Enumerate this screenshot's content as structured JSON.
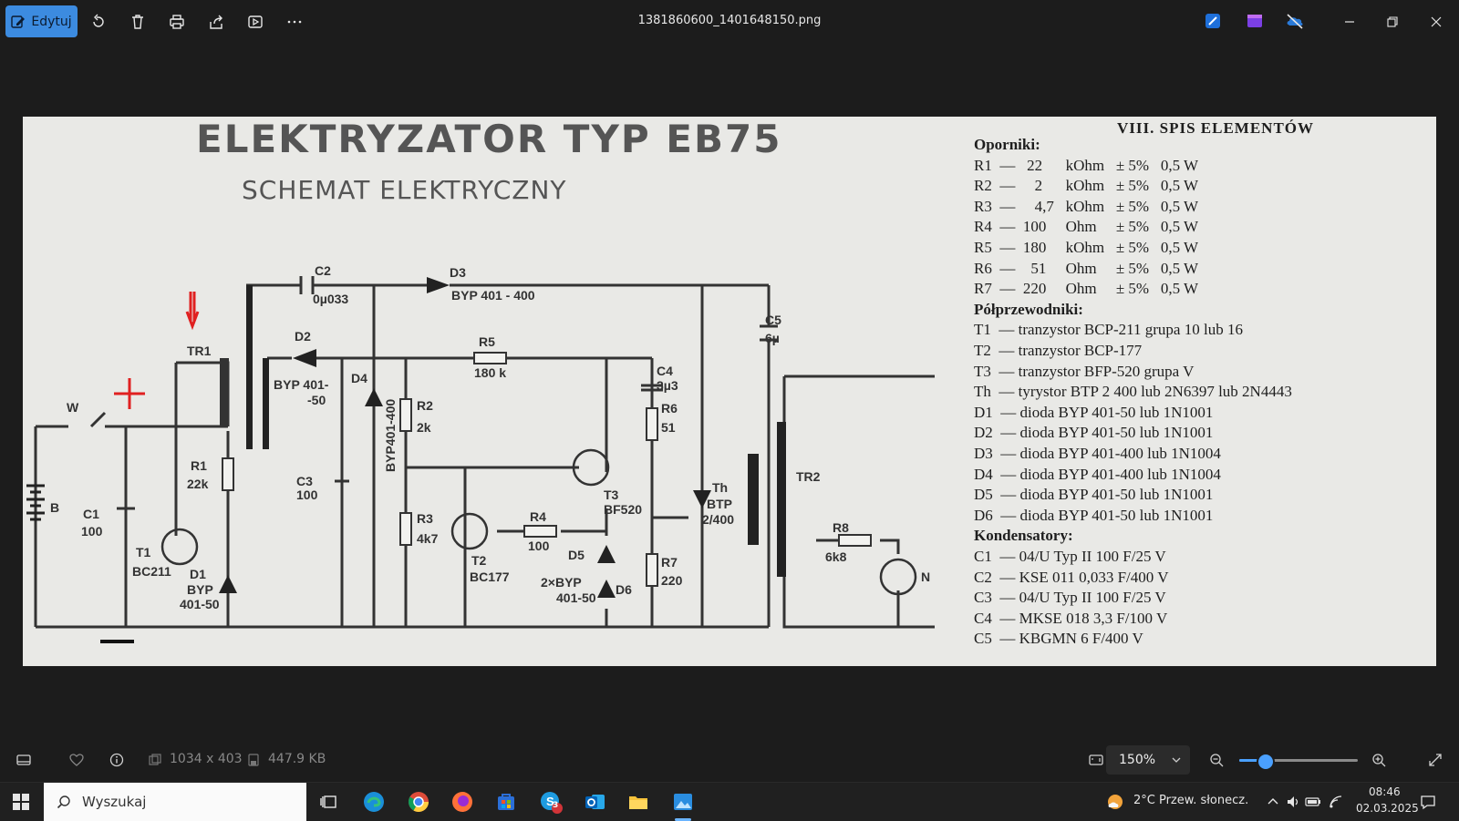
{
  "toolbar": {
    "edit_label": "Edytuj",
    "file_name": "1381860600_1401648150.png"
  },
  "image": {
    "title": "ELEKTRYZATOR TYP EB75",
    "subtitle": "SCHEMAT ELEKTRYCZNY",
    "labels": {
      "c2": "C2",
      "c2v": "0µ033",
      "d3": "D3",
      "d3v": "BYP 401 - 400",
      "d2": "D2",
      "d2v": "BYP 401-",
      "d2v2": "-50",
      "d4": "D4",
      "d4v": "BYP401-400",
      "r5": "R5",
      "r5v": "180 k",
      "c4": "C4",
      "c4v": "3µ3",
      "r6": "R6",
      "r6v": "51",
      "c5": "C5",
      "c5v": "6µ",
      "tr1": "TR1",
      "w": "W",
      "r2": "R2",
      "r2v": "2k",
      "c3": "C3",
      "c3v": "100",
      "r1": "R1",
      "r1v": "22k",
      "c1": "C1",
      "c1v": "100",
      "b": "B",
      "t1": "T1",
      "t1v": "BC211",
      "d1": "D1",
      "d1v": "BYP",
      "d1v2": "401-50",
      "r3": "R3",
      "r3v": "4k7",
      "r4": "R4",
      "r4v": "100",
      "t2": "T2",
      "t2v": "BC177",
      "t3": "T3",
      "t3v": "BF520",
      "th": "Th",
      "thv": "BTP",
      "thv2": "2/400",
      "d5": "D5",
      "d56v": "2×BYP",
      "d56v2": "401-50",
      "d6": "D6",
      "r7": "R7",
      "r7v": "220",
      "tr2": "TR2",
      "r8": "R8",
      "r8v": "6k8",
      "n": "N"
    },
    "parts_title": "VIII. SPIS ELEMENTÓW",
    "parts_lines": [
      "Oporniki:",
      "R1  —   22      kOhm   ± 5%   0,5 W",
      "R2  —     2      kOhm   ± 5%   0,5 W",
      "R3  —     4,7   kOhm   ± 5%   0,5 W",
      "R4  —  100     Ohm     ± 5%   0,5 W",
      "R5  —  180     kOhm   ± 5%   0,5 W",
      "R6  —    51     Ohm     ± 5%   0,5 W",
      "R7  —  220     Ohm     ± 5%   0,5 W",
      "Półprzewodniki:",
      "T1  — tranzystor BCP-211 grupa 10 lub 16",
      "T2  — tranzystor BCP-177",
      "T3  — tranzystor BFP-520 grupa V",
      "Th  — tyrystor BTP 2 400 lub 2N6397 lub 2N4443",
      "D1  — dioda BYP 401-50 lub 1N1001",
      "D2  — dioda BYP 401-50 lub 1N1001",
      "D3  — dioda BYP 401-400 lub 1N1004",
      "D4  — dioda BYP 401-400 lub 1N1004",
      "D5  — dioda BYP 401-50 lub 1N1001",
      "D6  — dioda BYP 401-50 lub 1N1001",
      "Kondensatory:",
      "C1  — 04/U Typ II 100 F/25 V",
      "C2  — KSE 011 0,033 F/400 V",
      "C3  — 04/U Typ II 100 F/25 V",
      "C4  — MKSE 018 3,3 F/100 V",
      "C5  — KBGMN 6 F/400 V"
    ]
  },
  "statusbar": {
    "dimensions": "1034 x 403",
    "file_size": "447.9 KB",
    "zoom": "150%",
    "zoom_slider_fraction": 0.22
  },
  "taskbar": {
    "search_placeholder": "Wyszukaj",
    "weather": "2°C  Przew. słonecz.",
    "time": "08:46",
    "date": "02.03.2025",
    "skype_badge": "3"
  },
  "colors": {
    "accent": "#3c8be0",
    "annotation_red": "#e02020",
    "slider": "#4aa0ff"
  }
}
